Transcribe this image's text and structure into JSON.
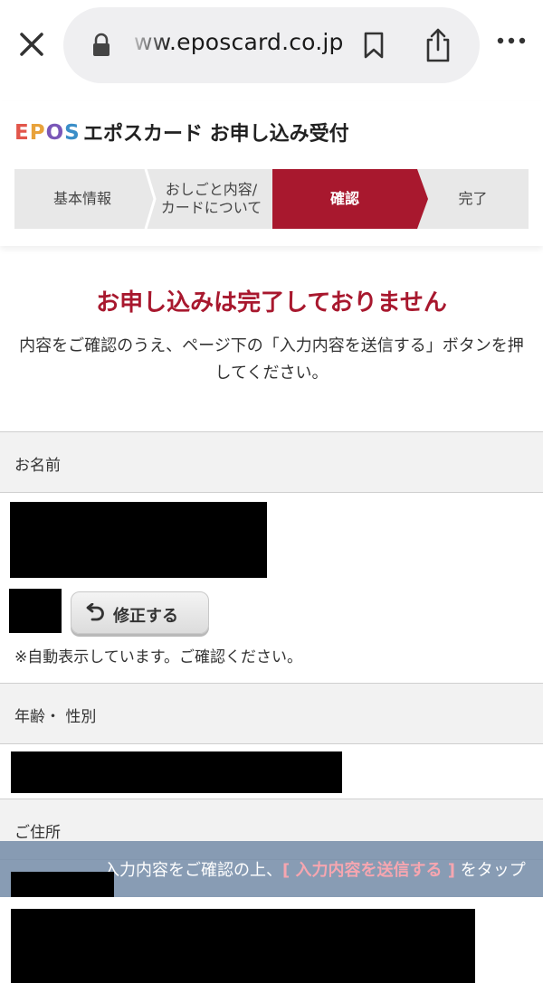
{
  "browser": {
    "url": "ww.eposcard.co.jp"
  },
  "header": {
    "logo": [
      "E",
      "P",
      "O",
      "S"
    ],
    "title": "エポスカード お申し込み受付"
  },
  "steps": [
    {
      "label": "基本情報",
      "state": "done"
    },
    {
      "label": "おしごと内容/\nカードについて",
      "state": "done"
    },
    {
      "label": "確認",
      "state": "active"
    },
    {
      "label": "完了",
      "state": "todo"
    }
  ],
  "notice": {
    "title": "お申し込みは完了しておりません",
    "text": "内容をご確認のうえ、ページ下の「入力内容を送信する」ボタンを押してください。"
  },
  "sections": {
    "name": {
      "label": "お名前"
    },
    "age_gender": {
      "label": "年齢・ 性別"
    },
    "address": {
      "label": "ご住所"
    }
  },
  "edit_button": {
    "label": "修正する"
  },
  "auto_note": "※自動表示しています。ご確認ください。",
  "banner": {
    "prefix": "入力内容をご確認の上、",
    "emphasis": "[ 入力内容を送信する ]",
    "suffix": " をタップ"
  },
  "colors": {
    "accent": "#a8182e",
    "banner": "#788eaa"
  }
}
